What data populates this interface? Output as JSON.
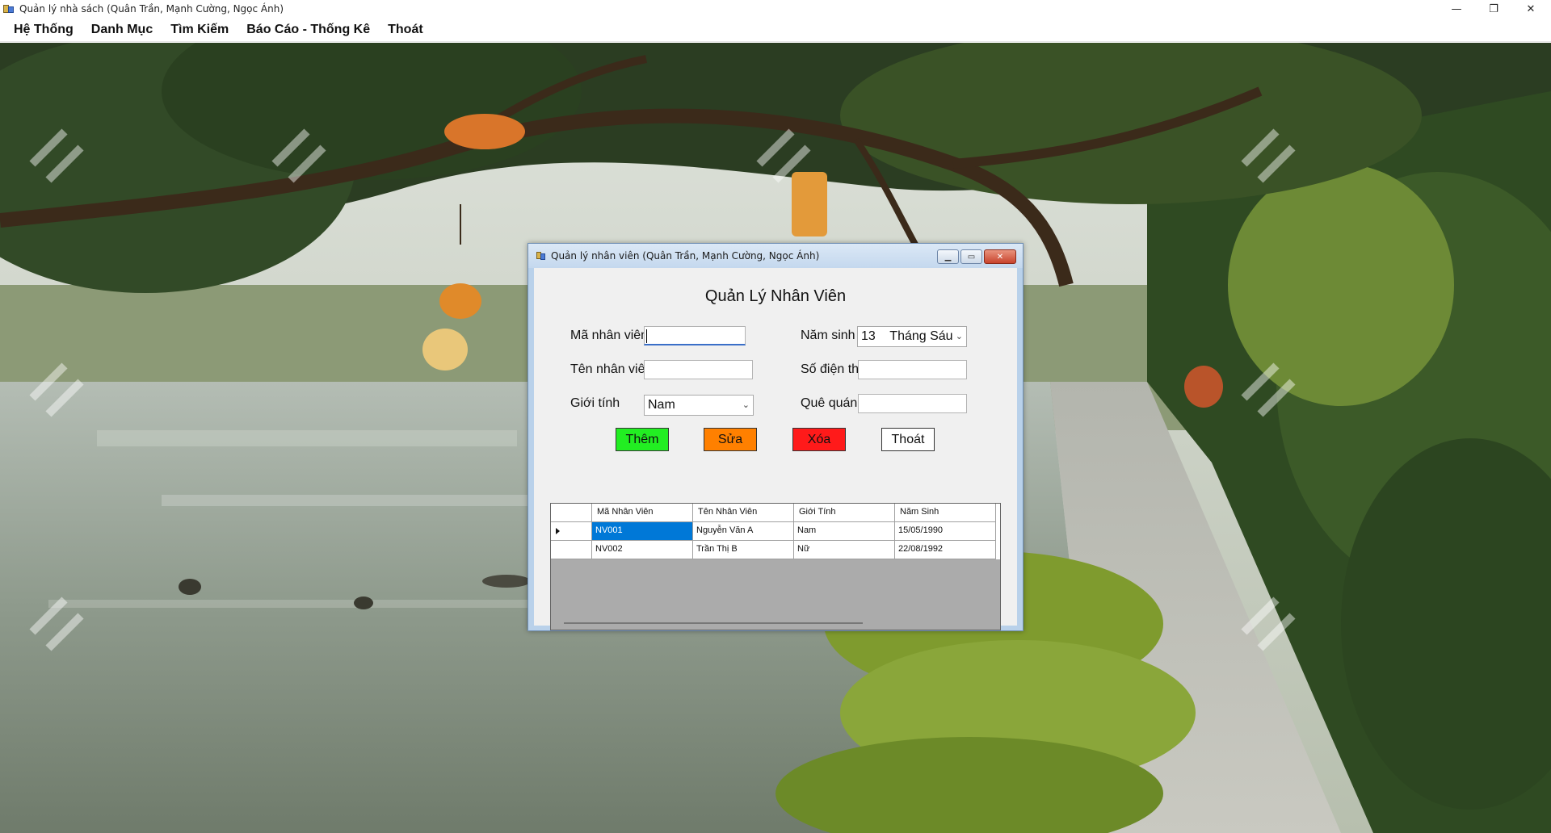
{
  "main_window": {
    "title": "Quản lý nhà sách (Quân Trần, Mạnh Cường, Ngọc Ánh)",
    "controls": {
      "minimize": "—",
      "maximize": "❐",
      "close": "✕"
    }
  },
  "menu": {
    "items": [
      "Hệ Thống",
      "Danh Mục",
      "Tìm Kiếm",
      "Báo Cáo - Thống Kê",
      "Thoát"
    ]
  },
  "dialog": {
    "title": "Quản lý nhân viên (Quân Trần, Mạnh Cường, Ngọc Ánh)",
    "controls": {
      "minimize": "▁",
      "maximize": "▭",
      "close": "✕"
    },
    "heading": "Quản Lý Nhân Viên",
    "fields": {
      "ma_nv": {
        "label": "Mã nhân viên",
        "value": ""
      },
      "ten_nv": {
        "label": "Tên nhân viên",
        "value": ""
      },
      "gioi_tinh": {
        "label": "Giới tính",
        "value": "Nam"
      },
      "nam_sinh": {
        "label": "Năm sinh",
        "value": "13    Tháng Sáu"
      },
      "so_dt": {
        "label": "Số điện thoại",
        "value": ""
      },
      "que_quan": {
        "label": "Quê quán",
        "value": ""
      }
    },
    "buttons": {
      "them": {
        "label": "Thêm",
        "color": "#22ee22"
      },
      "sua": {
        "label": "Sửa",
        "color": "#ff8000"
      },
      "xoa": {
        "label": "Xóa",
        "color": "#ff1a1a"
      },
      "thoat": {
        "label": "Thoát",
        "color": "#ffffff"
      }
    },
    "grid": {
      "columns": [
        "Mã Nhân Viên",
        "Tên Nhân Viên",
        "Giới Tính",
        "Năm Sinh"
      ],
      "rows": [
        [
          "NV001",
          "Nguyễn Văn A",
          "Nam",
          "15/05/1990"
        ],
        [
          "NV002",
          "Trần Thị B",
          "Nữ",
          "22/08/1992"
        ]
      ]
    }
  },
  "colors": {
    "dialog_frame": "#b9d1ea",
    "client_bg": "#f0f0f0",
    "selection": "#0078d7",
    "grid_empty": "#ababab"
  }
}
